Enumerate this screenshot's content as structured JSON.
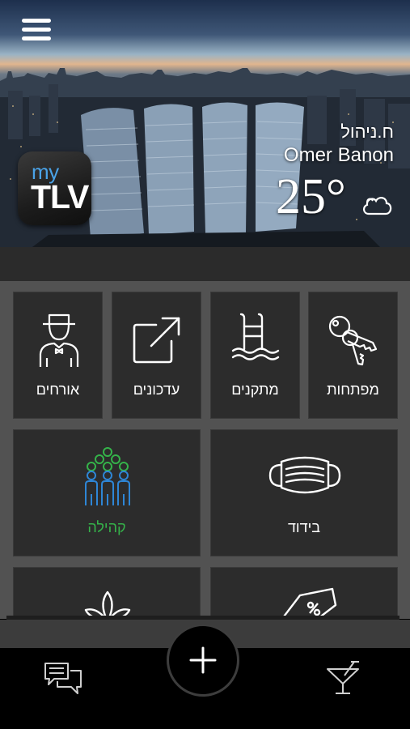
{
  "header": {
    "menu_icon": "hamburger-menu-icon",
    "logo": {
      "prefix": "my",
      "name": "TLV"
    },
    "management_label": "ח.ניהול",
    "user_name": "Omer Banon",
    "temperature": "25°",
    "weather_icon": "cloud-icon"
  },
  "tiles": [
    {
      "label": "מפתחות",
      "icon": "keys-icon"
    },
    {
      "label": "מתקנים",
      "icon": "pool-ladder-icon"
    },
    {
      "label": "עדכונים",
      "icon": "external-link-icon"
    },
    {
      "label": "אורחים",
      "icon": "guest-butler-icon"
    },
    {
      "label": "בידוד",
      "icon": "face-mask-icon"
    },
    {
      "label": "קהילה",
      "icon": "community-icon"
    },
    {
      "label": "",
      "icon": "price-tag-icon"
    },
    {
      "label": "",
      "icon": "lotus-icon"
    }
  ],
  "colors": {
    "community_accent": "#35b34a",
    "community_blue": "#2e86d6",
    "logo_blue": "#4aa3e8",
    "tile_bg": "#2c2c2c"
  },
  "bottom_nav": {
    "left_icon": "chat-icon",
    "center_icon": "plus-icon",
    "right_icon": "cocktail-icon"
  }
}
